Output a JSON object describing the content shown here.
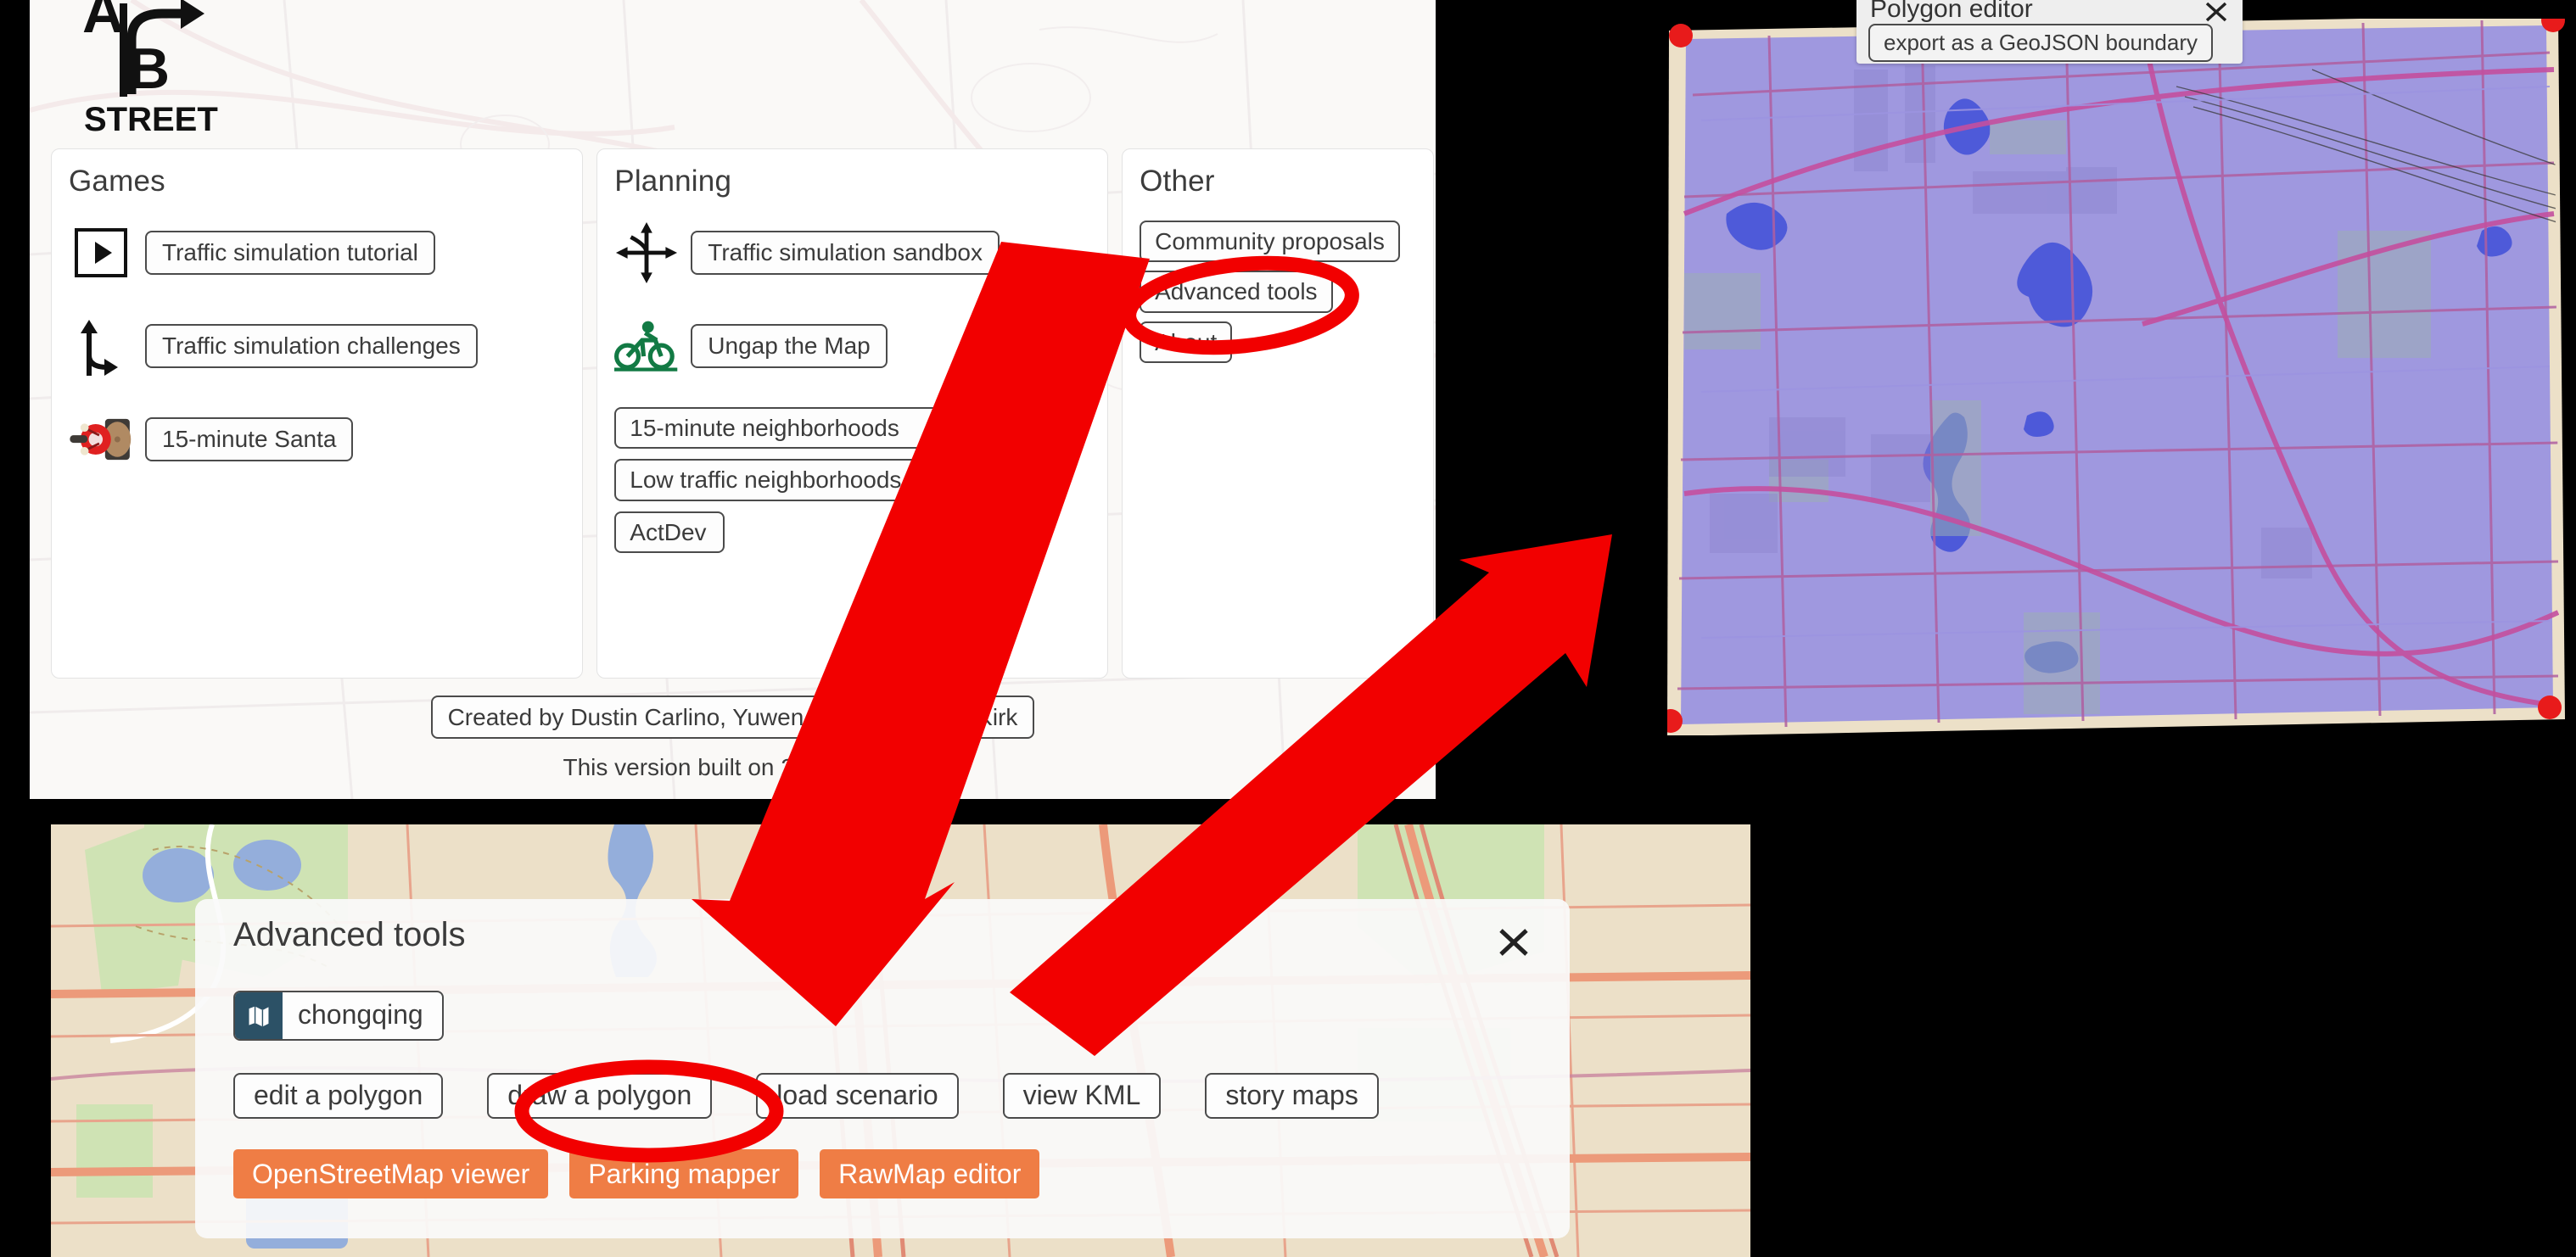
{
  "splash": {
    "logo_text": {
      "a": "A",
      "b": "B",
      "street": "STREET"
    },
    "cards": [
      {
        "heading": "Games",
        "items": [
          {
            "icon": "play-icon",
            "label": "Traffic simulation tutorial"
          },
          {
            "icon": "turn-right-icon",
            "label": "Traffic simulation challenges"
          },
          {
            "icon": "santa-icon",
            "label": "15-minute Santa"
          }
        ]
      },
      {
        "heading": "Planning",
        "items": [
          {
            "icon": "four-way-arrows-icon",
            "label": "Traffic simulation sandbox"
          },
          {
            "icon": "bicycle-icon",
            "label": "Ungap the Map"
          }
        ],
        "extra": [
          {
            "label": "15-minute neighborhoods"
          },
          {
            "label": "Low traffic neighborhoods"
          },
          {
            "label": "ActDev"
          }
        ]
      },
      {
        "heading": "Other",
        "extra": [
          {
            "label": "Community proposals"
          },
          {
            "label": "Advanced tools"
          },
          {
            "label": "About"
          }
        ]
      }
    ],
    "credits_button": "Created by Dustin Carlino, Yuwen Li, and Michael Kirk",
    "built_on": "This version built on 2023-03-26"
  },
  "polygon_editor": {
    "title": "Polygon editor",
    "export_button": "export as a GeoJSON boundary",
    "close_icon": "close-icon",
    "corner_handles": 4,
    "colors": {
      "fill": "#9b93e0",
      "handle": "#e81b1b",
      "land": "#ece0c8"
    }
  },
  "advanced_tools": {
    "title": "Advanced tools",
    "close_icon": "close-icon",
    "map_chip": {
      "icon": "map-icon",
      "label": "chongqing"
    },
    "outline_buttons": [
      "edit a polygon",
      "draw a polygon",
      "load scenario",
      "view KML",
      "story maps"
    ],
    "filled_buttons": [
      "OpenStreetMap viewer",
      "Parking mapper",
      "RawMap editor"
    ],
    "accent_color": "#ef7d45"
  },
  "annotations": {
    "highlight_color": "#f20000",
    "circles": [
      {
        "target": "Advanced tools"
      },
      {
        "target": "draw a polygon"
      }
    ],
    "arrows": [
      {
        "from": "Advanced tools",
        "to": "Advanced tools dialog"
      },
      {
        "from": "draw a polygon",
        "to": "Polygon editor"
      }
    ]
  }
}
